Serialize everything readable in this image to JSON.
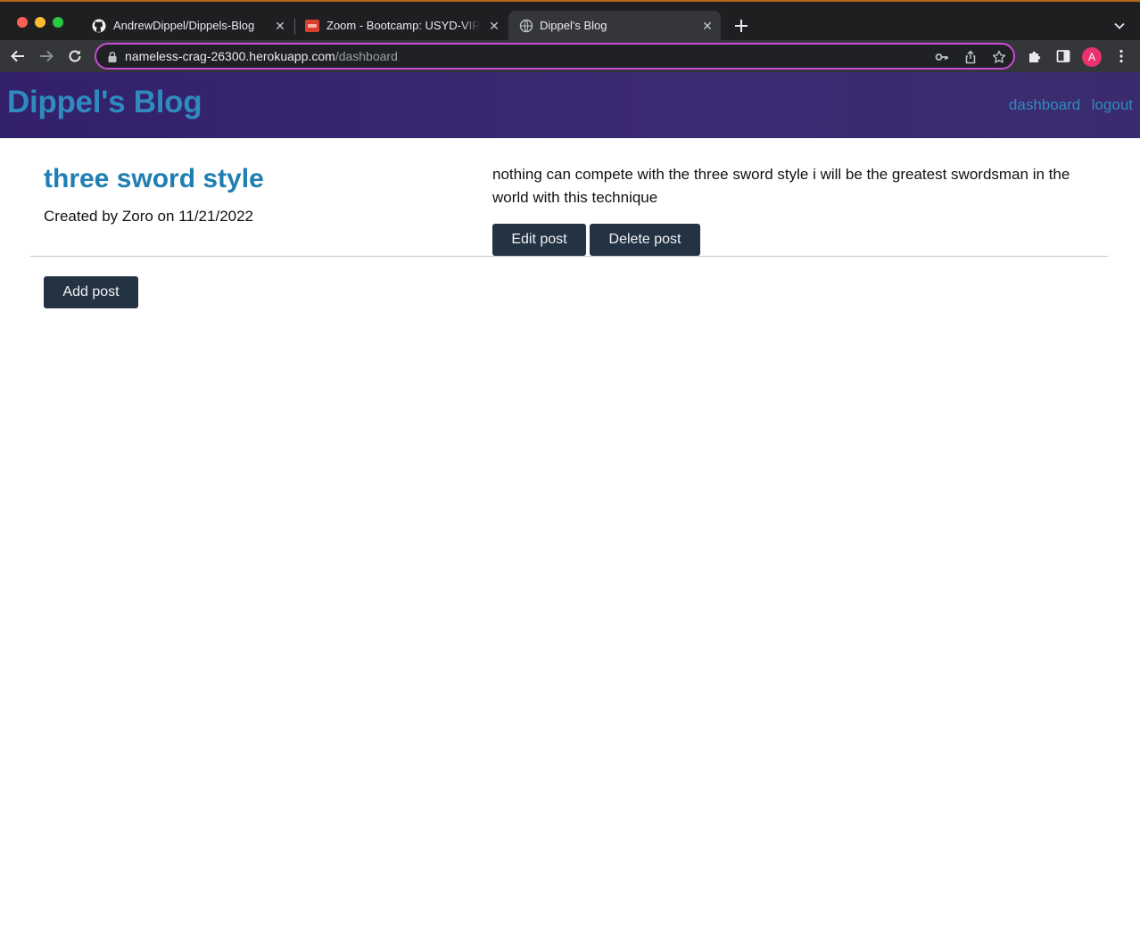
{
  "browser": {
    "tabs": [
      {
        "title": "AndrewDippel/Dippels-Blog",
        "icon": "github-icon"
      },
      {
        "title": "Zoom - Bootcamp: USYD-VIRT",
        "icon": "zoom-favicon"
      },
      {
        "title": "Dippel's Blog",
        "icon": "globe-icon",
        "active": true
      }
    ],
    "url_host": "nameless-crag-26300.herokuapp.com",
    "url_path": "/dashboard",
    "profile_initial": "A",
    "colors": {
      "omnibox_focus": "#c94bd8",
      "avatar": "#e8336d"
    }
  },
  "site": {
    "title": "Dippel's Blog",
    "nav": {
      "dashboard": "dashboard",
      "separator": "|",
      "logout": "logout"
    },
    "colors": {
      "header_bg": "#3a2870",
      "accent": "#2f8bbf",
      "button_bg": "#243344"
    }
  },
  "post": {
    "title": "three sword style",
    "meta": "Created by Zoro on 11/21/2022",
    "body": "nothing can compete with the three sword style i will be the greatest swordsman in the world with this technique",
    "edit_label": "Edit post",
    "delete_label": "Delete post"
  },
  "actions": {
    "add_label": "Add post"
  }
}
